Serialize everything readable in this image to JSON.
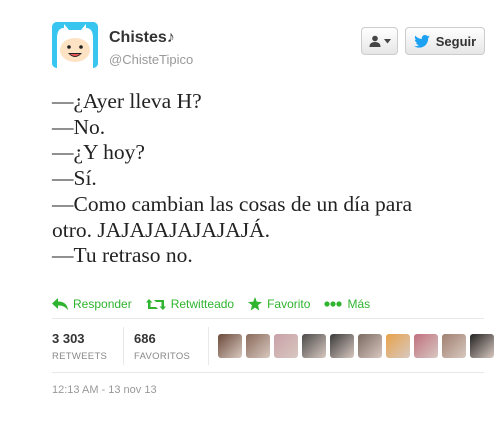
{
  "author": {
    "name": "Chistes♪",
    "handle": "@ChisteTipico"
  },
  "header": {
    "follow_label": "Seguir"
  },
  "tweet_lines": [
    "—¿Ayer lleva H?",
    "—No.",
    "—¿Y hoy?",
    "—Sí.",
    "—Como cambian las cosas de un día para",
    "otro. JAJAJAJAJAJAJÁ.",
    "—Tu retraso no."
  ],
  "actions": {
    "reply": "Responder",
    "retweet": "Retwitteado",
    "favorite": "Favorito",
    "more": "Más"
  },
  "stats": {
    "retweets_count": "3 303",
    "retweets_label": "RETWEETS",
    "favorites_count": "686",
    "favorites_label": "FAVORITOS"
  },
  "timestamp": "12:13 AM - 13 nov 13",
  "colors": {
    "action_green": "#2fb42f",
    "avatar_bg": "#38c5ef",
    "twitter_blue": "#1da1f2"
  },
  "icons": [
    "adventure-time-finn-avatar",
    "user-icon",
    "caret-down-icon",
    "twitter-bird-icon",
    "reply-icon",
    "retweet-icon",
    "star-icon",
    "more-dots-icon"
  ],
  "favoriter_avatars": [
    "#6b4a3a",
    "#8a6a5a",
    "#c9a0a8",
    "#4a4a4a",
    "#3a3a3a",
    "#7a6a60",
    "#e8a24a",
    "#c07080",
    "#a08070",
    "#222222"
  ]
}
